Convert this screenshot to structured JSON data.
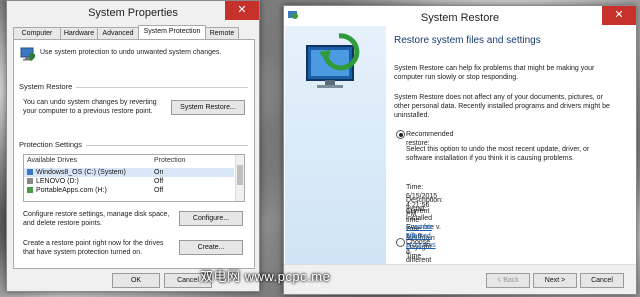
{
  "system_properties": {
    "title": "System Properties",
    "close_glyph": "✕",
    "tabs": [
      "Computer Name",
      "Hardware",
      "Advanced",
      "System Protection",
      "Remote"
    ],
    "intro": "Use system protection to undo unwanted system changes.",
    "restore_group": {
      "label": "System Restore",
      "text": "You can undo system changes by reverting your computer to a previous restore point.",
      "button": "System Restore..."
    },
    "protection_group": {
      "label": "Protection Settings",
      "columns": [
        "Available Drives",
        "Protection"
      ],
      "drives": [
        {
          "name": "Windows8_OS (C:) (System)",
          "protection": "On"
        },
        {
          "name": "LENOVO (D:)",
          "protection": "Off"
        },
        {
          "name": "PortableApps.com (H:)",
          "protection": "Off"
        }
      ],
      "configure_text": "Configure restore settings, manage disk space, and delete restore points.",
      "configure_button": "Configure...",
      "create_text": "Create a restore point right now for the drives that have system protection turned on.",
      "create_button": "Create..."
    },
    "ok_button": "OK",
    "cancel_button": "Cancel"
  },
  "system_restore": {
    "title": "System Restore",
    "close_glyph": "✕",
    "heading": "Restore system files and settings",
    "para1": "System Restore can help fix problems that might be making your computer run slowly or stop responding.",
    "para2": "System Restore does not affect any of your documents, pictures, or other personal data. Recently installed programs and drivers might be uninstalled.",
    "recommended_label": "Recommended restore:",
    "recommended_desc": "Select this option to undo the most recent update, driver, or software installation if you think it is causing problems.",
    "time_line": "Time: 6/15/2015 4:21:56 PM",
    "description_line": "Description: Install: Installed Evernote v. 5.8.9",
    "timezone_line": "Current time zone: Mountain Daylight Time",
    "scan_link": "Scan for affected programs",
    "different_label": "Choose a different restore point",
    "back_button": "< Back",
    "next_button": "Next >",
    "cancel_button": "Cancel"
  },
  "watermark": "双电网 www.pcpc.me",
  "colors": {
    "close_red": "#c7312c",
    "link_blue": "#1a5fb4",
    "pane_blue": "#cfe4f6"
  }
}
